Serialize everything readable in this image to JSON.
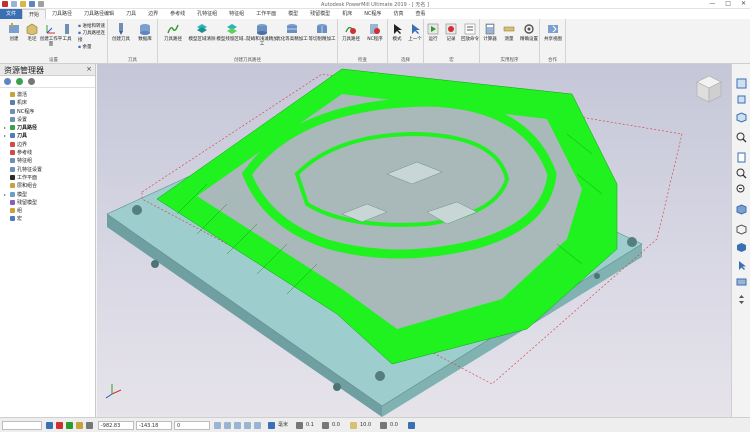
{
  "window": {
    "title": "Autodesk PowerMill Ultimate 2019  -  [ 无名 ]",
    "controls": [
      "—",
      "□",
      "✕"
    ]
  },
  "ribbon_tabs": [
    {
      "label": "文件",
      "state": "file"
    },
    {
      "label": "开始",
      "state": "active"
    },
    {
      "label": "刀具路径",
      "state": ""
    },
    {
      "label": "刀具路径编辑",
      "state": ""
    },
    {
      "label": "刀具",
      "state": ""
    },
    {
      "label": "边界",
      "state": ""
    },
    {
      "label": "参考线",
      "state": ""
    },
    {
      "label": "孔特征组",
      "state": ""
    },
    {
      "label": "特征组",
      "state": ""
    },
    {
      "label": "工作平面",
      "state": ""
    },
    {
      "label": "模型",
      "state": ""
    },
    {
      "label": "残留模型",
      "state": ""
    },
    {
      "label": "机床",
      "state": ""
    },
    {
      "label": "NC程序",
      "state": ""
    },
    {
      "label": "仿真",
      "state": ""
    },
    {
      "label": "查看",
      "state": ""
    }
  ],
  "ribbon_groups": {
    "setup": {
      "label": "设置",
      "buttons": [
        "创建",
        "毛坯",
        "创建工作平面",
        "进给和转速",
        "刀具路径连接",
        "余量",
        "工具"
      ]
    },
    "tool": {
      "label": "刀具",
      "buttons": [
        "创建刀具",
        "数据库"
      ]
    },
    "create_toolpath": {
      "label": "创建刀具路径",
      "buttons": [
        "刀具路径",
        "模型区域清除",
        "模型残留区域...",
        "陡峭和浅滩精加工",
        "优化等高精加工",
        "等切削精加工"
      ]
    },
    "check": {
      "label": "检查",
      "buttons": [
        "刀具路径",
        "NC程序"
      ]
    },
    "select": {
      "label": "选择",
      "buttons": [
        "模式",
        "上一个"
      ]
    },
    "macro": {
      "label": "宏",
      "buttons": [
        "运行",
        "记录",
        "回放命令"
      ]
    },
    "utilities": {
      "label": "实用程序",
      "buttons": [
        "计算器",
        "测量",
        "精确设置"
      ]
    },
    "collab": {
      "label": "合作",
      "buttons": [
        "共享视图"
      ]
    }
  },
  "explorer": {
    "title": "资源管理器",
    "close_icon": "×",
    "items": [
      {
        "label": "激活",
        "icon": "#c7a43a",
        "toggle": "",
        "bold": false
      },
      {
        "label": "机床",
        "icon": "#5a7ea8",
        "toggle": "",
        "bold": false
      },
      {
        "label": "NC程序",
        "icon": "#6f8fb6",
        "toggle": "",
        "bold": false
      },
      {
        "label": "设置",
        "icon": "#6f8fb6",
        "toggle": "",
        "bold": false
      },
      {
        "label": "刀具路径",
        "icon": "#3aa04a",
        "toggle": "▸",
        "bold": true
      },
      {
        "label": "刀具",
        "icon": "#4d7cc0",
        "toggle": "▸",
        "bold": true
      },
      {
        "label": "边界",
        "icon": "#d04a4a",
        "toggle": "",
        "bold": false
      },
      {
        "label": "参考线",
        "icon": "#d04a4a",
        "toggle": "",
        "bold": false
      },
      {
        "label": "特征组",
        "icon": "#6f8fb6",
        "toggle": "",
        "bold": false
      },
      {
        "label": "孔特征设置",
        "icon": "#6f8fb6",
        "toggle": "",
        "bold": false
      },
      {
        "label": "工作平面",
        "icon": "#2a2a2a",
        "toggle": "",
        "bold": false
      },
      {
        "label": "层和组合",
        "icon": "#c7a43a",
        "toggle": "",
        "bold": false
      },
      {
        "label": "模型",
        "icon": "#6aa0c8",
        "toggle": "▸",
        "bold": false
      },
      {
        "label": "残留模型",
        "icon": "#8a5cbf",
        "toggle": "",
        "bold": false
      },
      {
        "label": "组",
        "icon": "#c7a43a",
        "toggle": "",
        "bold": false
      },
      {
        "label": "宏",
        "icon": "#4d7cc0",
        "toggle": "",
        "bold": false
      }
    ]
  },
  "status_bar": {
    "x": "-982.83",
    "y": "-143.18",
    "z": "0",
    "unit": "毫米",
    "tool_value": "0.1",
    "angle": "0.0",
    "field_a": "10.0",
    "field_b": "0.0"
  },
  "colors": {
    "accent": "#3a6fb4",
    "toolpath": "#1ff21f",
    "part": "#8fbfbf",
    "boundary": "#d23a3a"
  }
}
